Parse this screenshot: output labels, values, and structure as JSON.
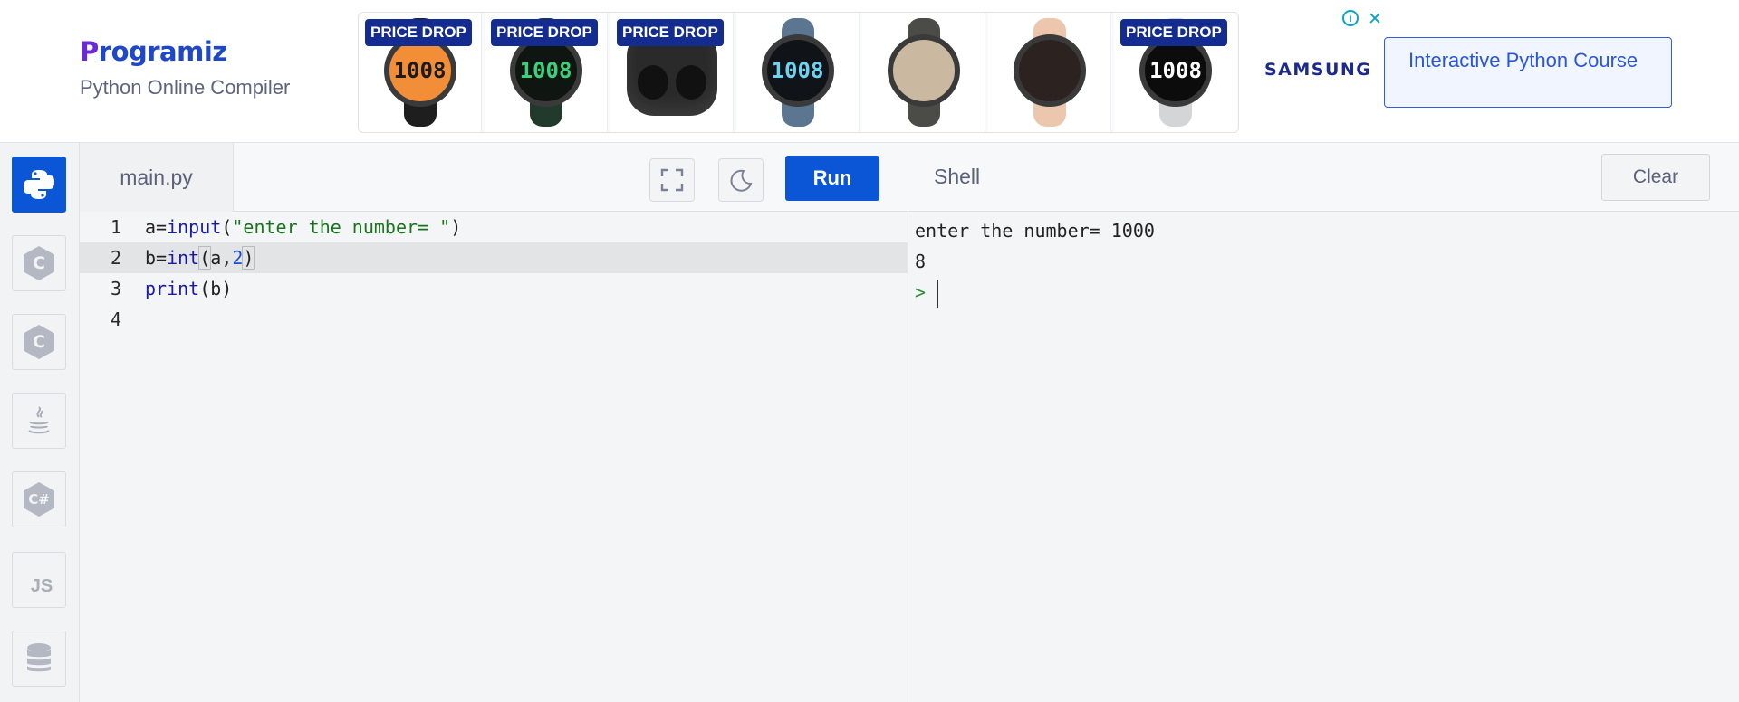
{
  "brand": {
    "logo_initial": "P",
    "logo_rest": "rogramiz",
    "tagline": "Python Online Compiler"
  },
  "ad": {
    "tiles": [
      {
        "badge": "PRICE DROP",
        "kind": "watch",
        "strap": "#1e1e1e",
        "face_bg": "#f28d38",
        "face_fg": "#1b1b1b",
        "time_h": "10",
        "time_m": "08"
      },
      {
        "badge": "PRICE DROP",
        "kind": "watch",
        "strap": "#213a2c",
        "face_bg": "#0f1510",
        "face_fg": "#3ad17a",
        "time_h": "10",
        "time_m": "08"
      },
      {
        "badge": "PRICE DROP",
        "kind": "buds",
        "strap": "#222222"
      },
      {
        "badge": "",
        "kind": "watch",
        "strap": "#5c7590",
        "face_bg": "#101418",
        "face_fg": "#6ed3f0",
        "time_h": "10",
        "time_m": "08"
      },
      {
        "badge": "",
        "kind": "watch",
        "strap": "#4b4c47",
        "face_bg": "#cbb8a1",
        "face_fg": "#5a4a39",
        "time_h": "",
        "time_m": ""
      },
      {
        "badge": "",
        "kind": "watch",
        "strap": "#ecc6ad",
        "face_bg": "#2c2321",
        "face_fg": "#f0a9a2",
        "time_h": "",
        "time_m": ""
      },
      {
        "badge": "PRICE DROP",
        "kind": "watch",
        "strap": "#d4d5d7",
        "face_bg": "#0c0c0c",
        "face_fg": "#ffffff",
        "time_h": "10",
        "time_m": "08"
      }
    ],
    "advertiser": "SAMSUNG",
    "info_icon": "info-icon",
    "close_icon": "close-icon",
    "cta": "Interactive Python Course"
  },
  "sidebar": {
    "items": [
      {
        "name": "python",
        "label": "",
        "active": true
      },
      {
        "name": "c",
        "label": "C",
        "active": false
      },
      {
        "name": "cpp",
        "label": "C",
        "active": false
      },
      {
        "name": "java",
        "label": "",
        "active": false
      },
      {
        "name": "csharp",
        "label": "C#",
        "active": false
      },
      {
        "name": "javascript",
        "label": "JS",
        "active": false
      },
      {
        "name": "sql",
        "label": "",
        "active": false
      }
    ]
  },
  "editor": {
    "file_tab": "main.py",
    "run_label": "Run",
    "line_numbers": [
      "1",
      "2",
      "3",
      "4"
    ],
    "active_line": 2
  },
  "shell": {
    "title": "Shell",
    "clear_label": "Clear",
    "output": [
      "enter the number= 1000",
      "8"
    ],
    "prompt": ">"
  },
  "colors": {
    "accent": "#0b56d6",
    "ad_badge": "#142c8f",
    "string": "#18751c",
    "keyword": "#1a1aa8"
  }
}
